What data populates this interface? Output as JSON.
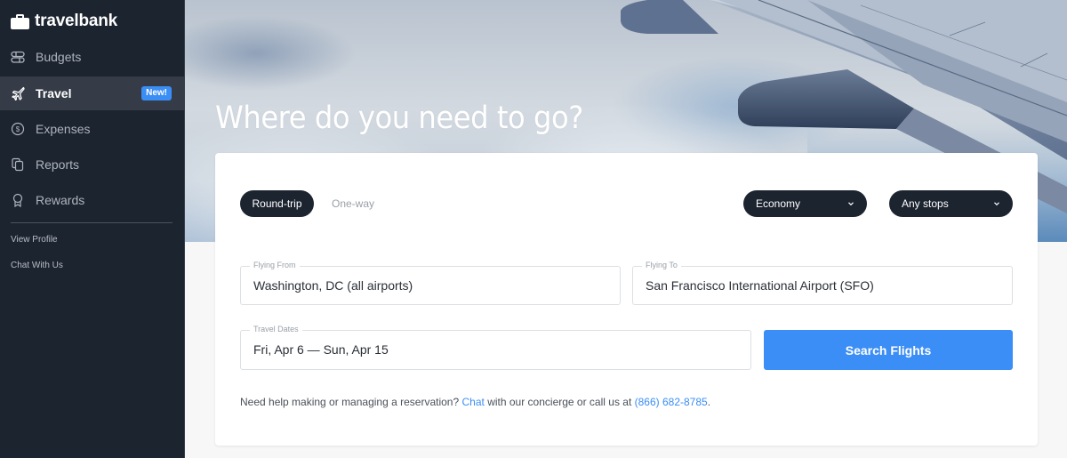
{
  "brand": {
    "name": "travelbank",
    "icon": "briefcase-icon"
  },
  "sidebar": {
    "items": [
      {
        "label": "Budgets",
        "icon": "budgets-icon",
        "active": false
      },
      {
        "label": "Travel",
        "icon": "plane-icon",
        "active": true,
        "badge": "New!"
      },
      {
        "label": "Expenses",
        "icon": "dollar-circle-icon",
        "active": false
      },
      {
        "label": "Reports",
        "icon": "reports-icon",
        "active": false
      },
      {
        "label": "Rewards",
        "icon": "award-icon",
        "active": false
      }
    ],
    "links": [
      {
        "label": "View Profile"
      },
      {
        "label": "Chat With Us"
      }
    ]
  },
  "hero": {
    "title": "Where do you need to go?"
  },
  "search": {
    "trip_types": [
      {
        "label": "Round-trip",
        "selected": true
      },
      {
        "label": "One-way",
        "selected": false
      }
    ],
    "cabin_class": {
      "value": "Economy"
    },
    "stops": {
      "value": "Any stops"
    },
    "from": {
      "label": "Flying From",
      "value": "Washington, DC (all airports)"
    },
    "to": {
      "label": "Flying To",
      "value": "San Francisco International Airport (SFO)"
    },
    "dates": {
      "label": "Travel Dates",
      "value": "Fri, Apr 6 — Sun, Apr 15"
    },
    "submit_label": "Search Flights"
  },
  "help": {
    "prefix": "Need help making or managing a reservation?",
    "chat_link": "Chat",
    "middle": "with our concierge or call us at",
    "phone": "(866) 682-8785",
    "suffix": "."
  },
  "colors": {
    "sidebar_bg": "#1c2430",
    "active_item_bg": "#353c47",
    "accent": "#3b8ef5",
    "page_bg": "#f7f7f7"
  }
}
